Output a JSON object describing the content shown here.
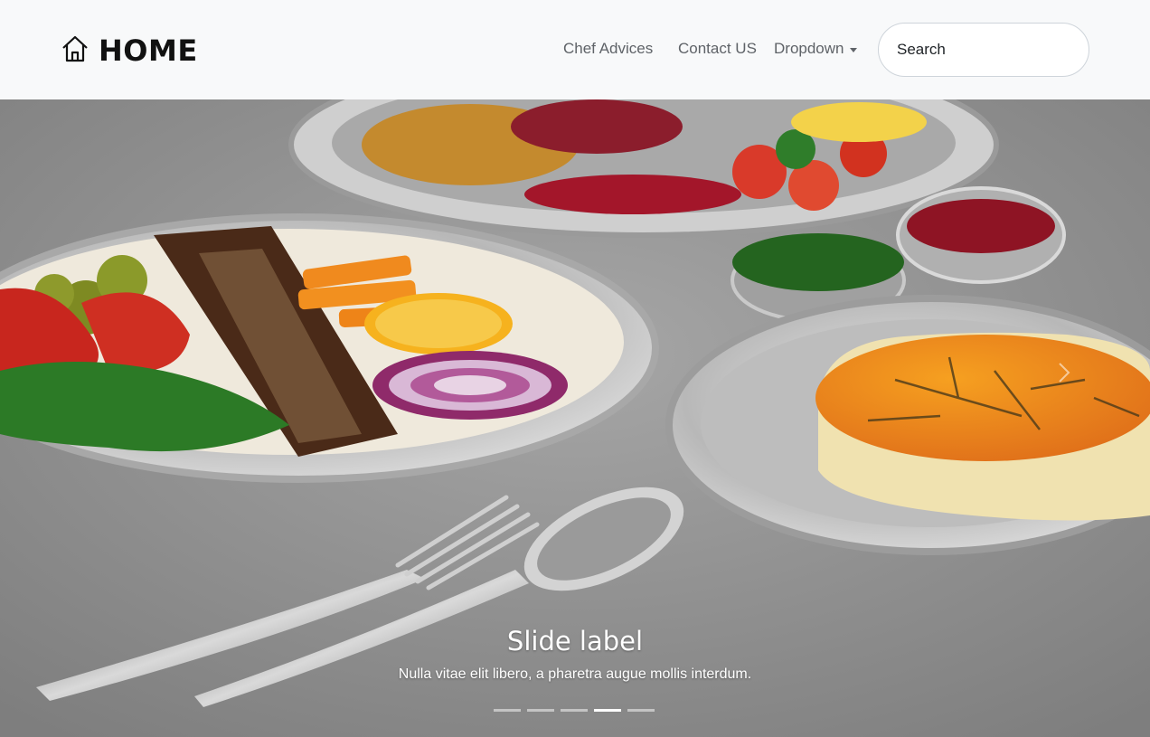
{
  "navbar": {
    "brand": "HOME",
    "brand_icon": "house-icon",
    "links": [
      "Chef Advices",
      "Contact US",
      "Dropdown"
    ],
    "search_placeholder": "Search"
  },
  "carousel": {
    "slide_label": "Slide label",
    "slide_text": "Nulla vitae elit libero, a pharetra augue mollis interdum.",
    "indicator_count": 5,
    "active_index": 3,
    "photo": "Persian food on silver platters with fork and spoon"
  }
}
